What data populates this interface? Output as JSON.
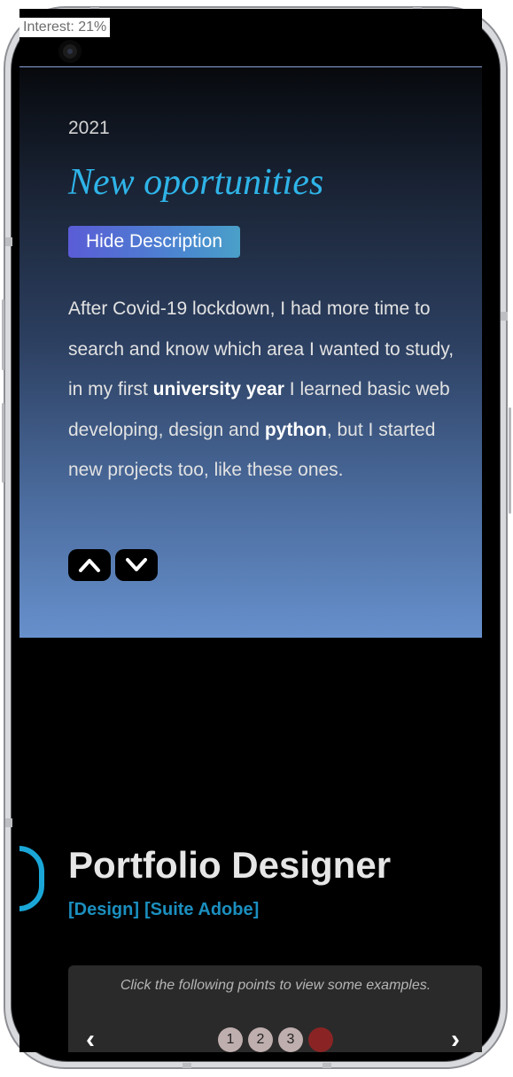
{
  "status": {
    "interest": "Interest: 21%"
  },
  "section": {
    "year": "2021",
    "title": "New oportunities",
    "toggle_label": "Hide Description",
    "description": {
      "p1": "After Covid-19 lockdown, I had more time to search and know which area I wanted to study, in my first ",
      "b1": "university year",
      "p2": " I learned basic web developing, design and ",
      "b2": "python",
      "p3": ", but I started new projects too, like these ones."
    },
    "nav": {
      "up_icon": "chevron-up-icon",
      "down_icon": "chevron-down-icon"
    }
  },
  "portfolio": {
    "title": "Portfolio Designer",
    "tags": [
      "[Design]",
      "[Suite Adobe]"
    ],
    "examples_hint": "Click the following points to view some examples.",
    "pager": {
      "prev": "‹",
      "next": "›",
      "pages": [
        "1",
        "2",
        "3"
      ]
    }
  },
  "colors": {
    "accent": "#2fb4e8",
    "tag": "#1b8fbf",
    "active_dot": "#8a2424"
  }
}
